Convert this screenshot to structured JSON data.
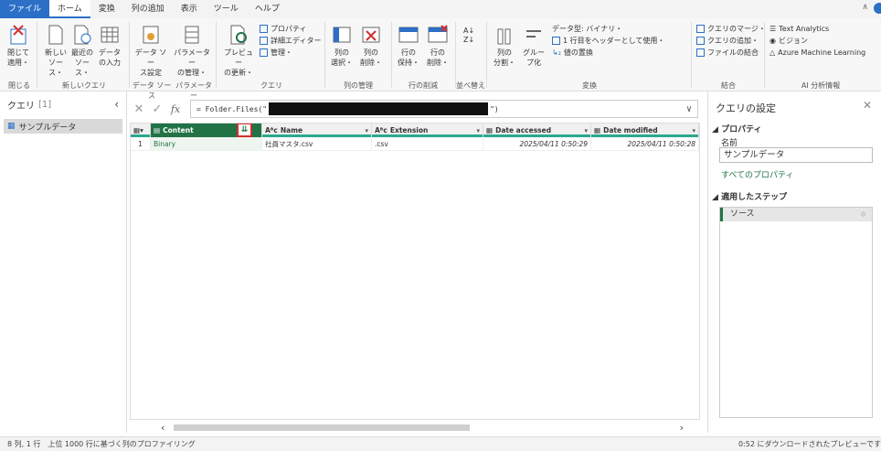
{
  "tabs": [
    "ファイル",
    "ホーム",
    "変換",
    "列の追加",
    "表示",
    "ツール",
    "ヘルプ"
  ],
  "ribbon": {
    "close_apply": "閉じて\n適用・",
    "new_source": "新しい\nソース・",
    "recent_source": "最近の\nソース・",
    "enter_data": "データ\nの入力",
    "data_source_settings": "データ ソー\nス設定",
    "manage_params": "パラメーター\nの管理・",
    "refresh_preview": "プレビュー\nの更新・",
    "properties": "プロパティ",
    "advanced_editor": "詳細エディター",
    "manage": "管理・",
    "choose_columns": "列の\n選択・",
    "remove_columns": "列の\n削除・",
    "keep_rows": "行の\n保持・",
    "remove_rows": "行の\n削除・",
    "split_column": "列の\n分割・",
    "group_by": "グルー\nプ化",
    "data_type": "データ型: バイナリ・",
    "first_row_header": "1 行目をヘッダーとして使用・",
    "replace_values": "値の置換",
    "merge_queries": "クエリのマージ・",
    "append_queries": "クエリの追加・",
    "combine_files": "ファイルの結合",
    "text_analytics": "Text Analytics",
    "vision": "ビジョン",
    "azure_ml": "Azure Machine Learning",
    "groups": {
      "close": "閉じる",
      "new_query": "新しいクエリ",
      "data_sources": "データ ソース",
      "parameters": "パラメーター",
      "query": "クエリ",
      "manage_columns": "列の管理",
      "reduce_rows": "行の削減",
      "sort": "並べ替え",
      "transform": "変換",
      "combine": "結合",
      "ai_insights": "AI 分析情報"
    }
  },
  "queries": {
    "title": "クエリ",
    "count": "[1]",
    "items": [
      "サンプルデータ"
    ]
  },
  "formula": {
    "prefix": "= Folder.Files(\"",
    "suffix": "\")"
  },
  "grid": {
    "columns": [
      "Content",
      "Name",
      "Extension",
      "Date accessed",
      "Date modified"
    ],
    "rows": [
      {
        "index": "1",
        "content": "Binary",
        "name": "社員マスタ.csv",
        "extension": ".csv",
        "date_accessed": "2025/04/11 0:50:29",
        "date_modified": "2025/04/11 0:50:28"
      }
    ]
  },
  "settings": {
    "title": "クエリの設定",
    "properties_header": "プロパティ",
    "name_label": "名前",
    "name_value": "サンプルデータ",
    "all_properties": "すべてのプロパティ",
    "applied_steps_header": "適用したステップ",
    "steps": [
      "ソース"
    ]
  },
  "status": {
    "left": "8 列, 1 行　上位 1000 行に基づく列のプロファイリング",
    "right": "0:52 にダウンロードされたプレビューです"
  }
}
